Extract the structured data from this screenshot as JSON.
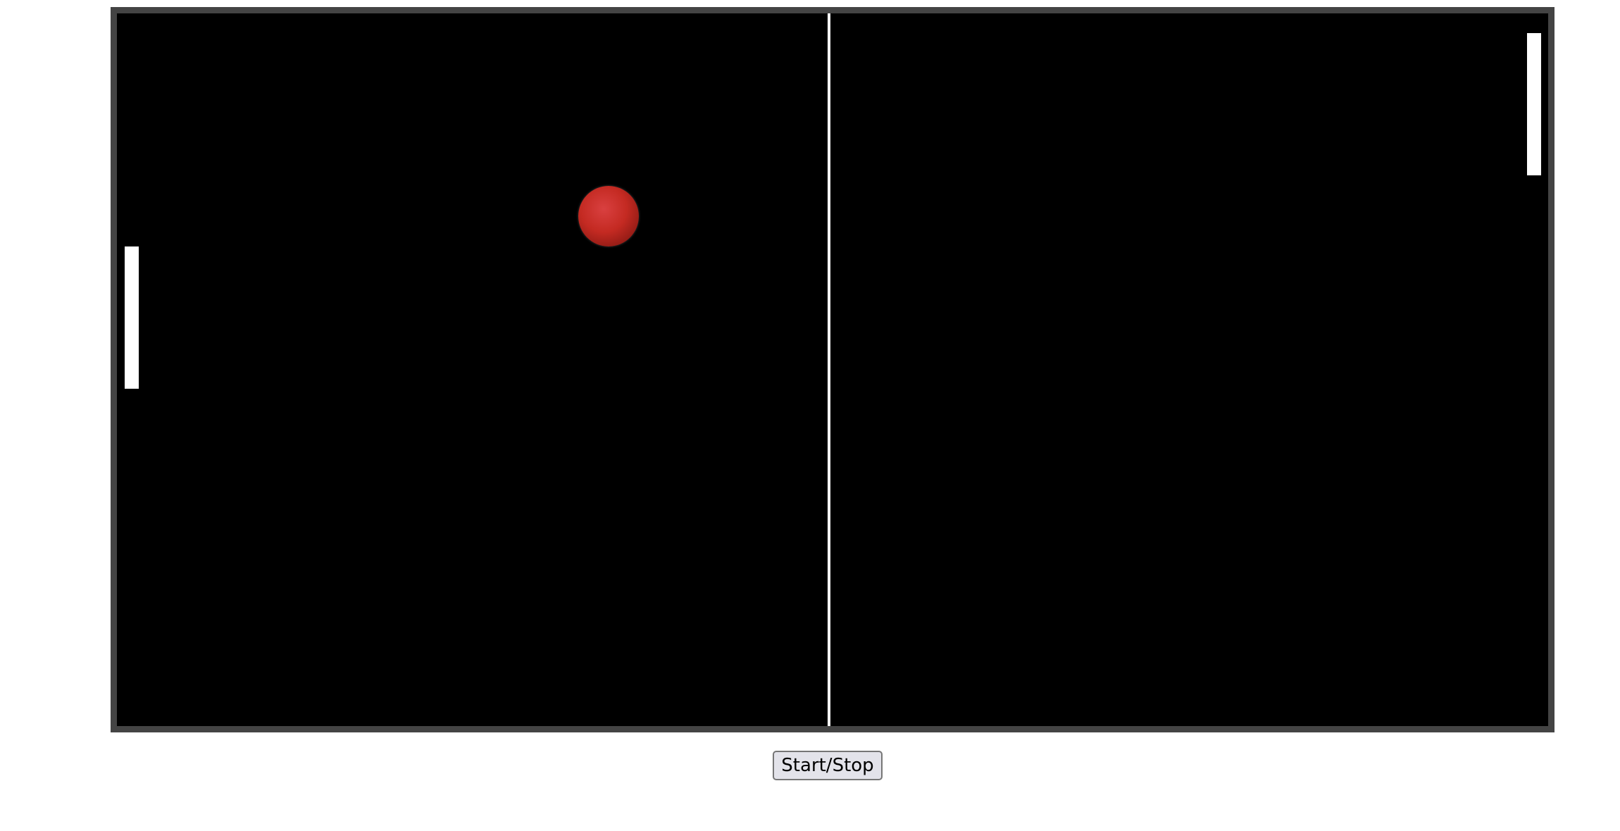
{
  "game": {
    "name": "pong",
    "colors": {
      "court": "#000000",
      "border": "#444444",
      "net": "#ffffff",
      "paddle": "#ffffff",
      "ball": "#c42a22"
    }
  },
  "controls": {
    "start_stop_label": "Start/Stop"
  }
}
